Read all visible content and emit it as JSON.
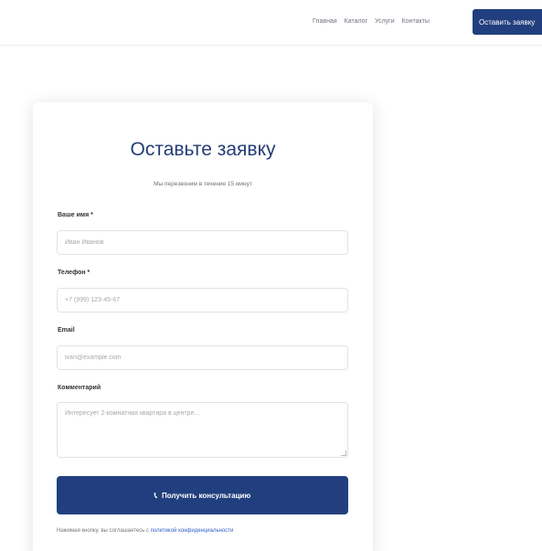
{
  "nav": {
    "items": [
      "Главная",
      "Каталог",
      "Услуги",
      "Контакты"
    ],
    "cta_label": "Оставить заявку"
  },
  "form": {
    "title": "Оставьте заявку",
    "subtitle": "Мы перезвоним в течение 15 минут",
    "name": {
      "label": "Ваше имя *",
      "placeholder": "Иван Иванов"
    },
    "phone": {
      "label": "Телефон *",
      "placeholder": "+7 (999) 123-45-67"
    },
    "email": {
      "label": "Email",
      "placeholder": "ivan@example.com"
    },
    "comment": {
      "label": "Комментарий",
      "placeholder": "Интересует 2-комнатная квартира в центре..."
    },
    "submit_label": "Получить консультацию",
    "phone_icon": "phone-icon",
    "consent_text": "Нажимая кнопку, вы соглашаетесь с ",
    "consent_link": "политикой конфиденциальности"
  },
  "colors": {
    "primary": "#213f7e",
    "title": "#243d75",
    "link": "#2f5fc7"
  }
}
